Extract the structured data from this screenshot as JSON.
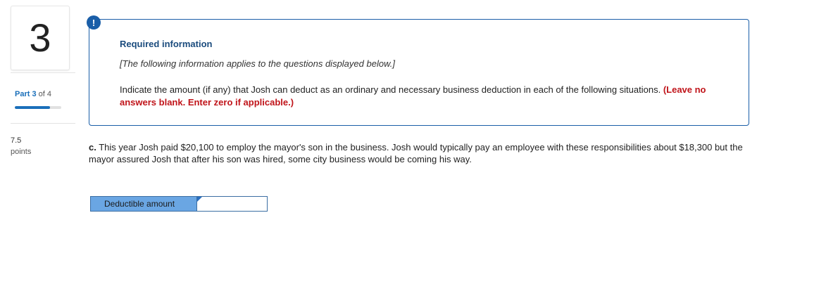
{
  "rail": {
    "question_number": "3",
    "part_word": "Part",
    "part_current": "3",
    "part_of": "of 4",
    "progress_fraction": 0.75,
    "points_value": "7.5",
    "points_label": "points"
  },
  "alert": {
    "badge": "!"
  },
  "info": {
    "title": "Required information",
    "note": "[The following information applies to the questions displayed below.]",
    "body": "Indicate the amount (if any) that Josh can deduct as an ordinary and necessary business deduction in each of the following situations.",
    "instruction": "(Leave no answers blank. Enter zero if applicable.)"
  },
  "question": {
    "letter": "c.",
    "text": "This year Josh paid $20,100 to employ the mayor's son in the business. Josh would typically pay an employee with these responsibilities about $18,300 but the mayor assured Josh that after his son was hired, some city business would be coming his way."
  },
  "answer": {
    "label": "Deductible amount",
    "value": ""
  },
  "colors": {
    "accent_blue": "#1a5ea8",
    "label_cell": "#6aa6e3",
    "instruction_red": "#c0141a"
  }
}
